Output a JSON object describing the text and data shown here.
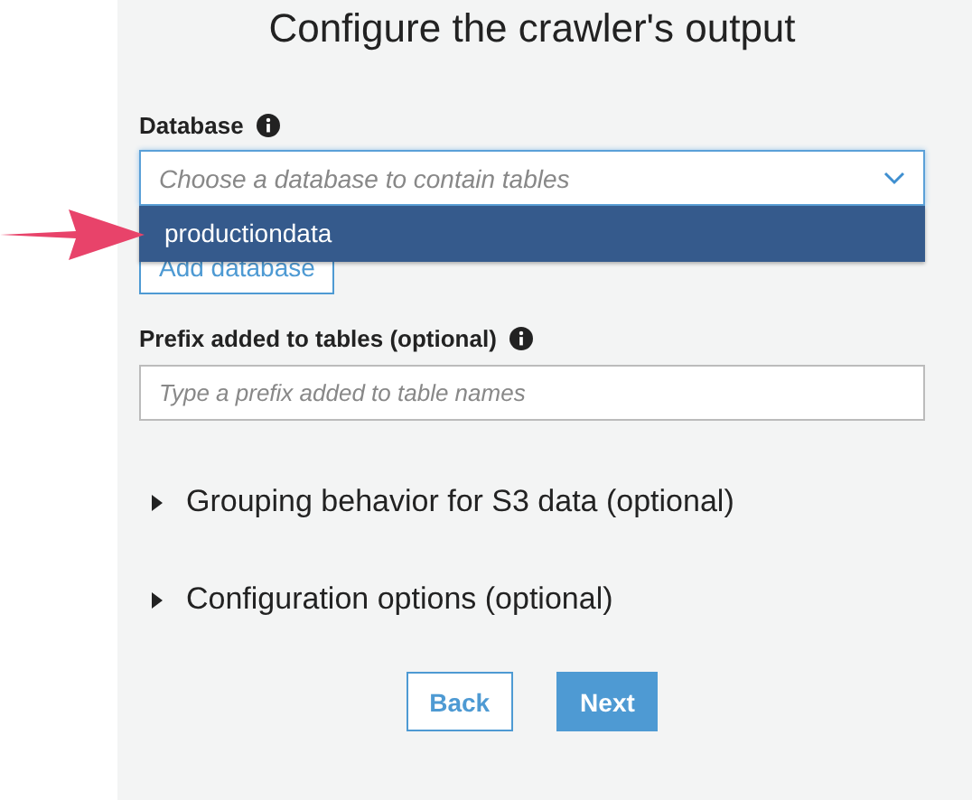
{
  "title": "Configure the crawler's output",
  "database": {
    "label": "Database",
    "placeholder": "Choose a database to contain tables",
    "options": [
      {
        "label": "productiondata",
        "selected": true
      }
    ],
    "add_button": "Add database"
  },
  "prefix": {
    "label": "Prefix added to tables (optional)",
    "placeholder": "Type a prefix added to table names"
  },
  "sections": [
    {
      "label": "Grouping behavior for S3 data (optional)",
      "expanded": false
    },
    {
      "label": "Configuration options (optional)",
      "expanded": false
    }
  ],
  "buttons": [
    {
      "label": "Back",
      "kind": "secondary"
    },
    {
      "label": "Next",
      "kind": "primary"
    }
  ]
}
